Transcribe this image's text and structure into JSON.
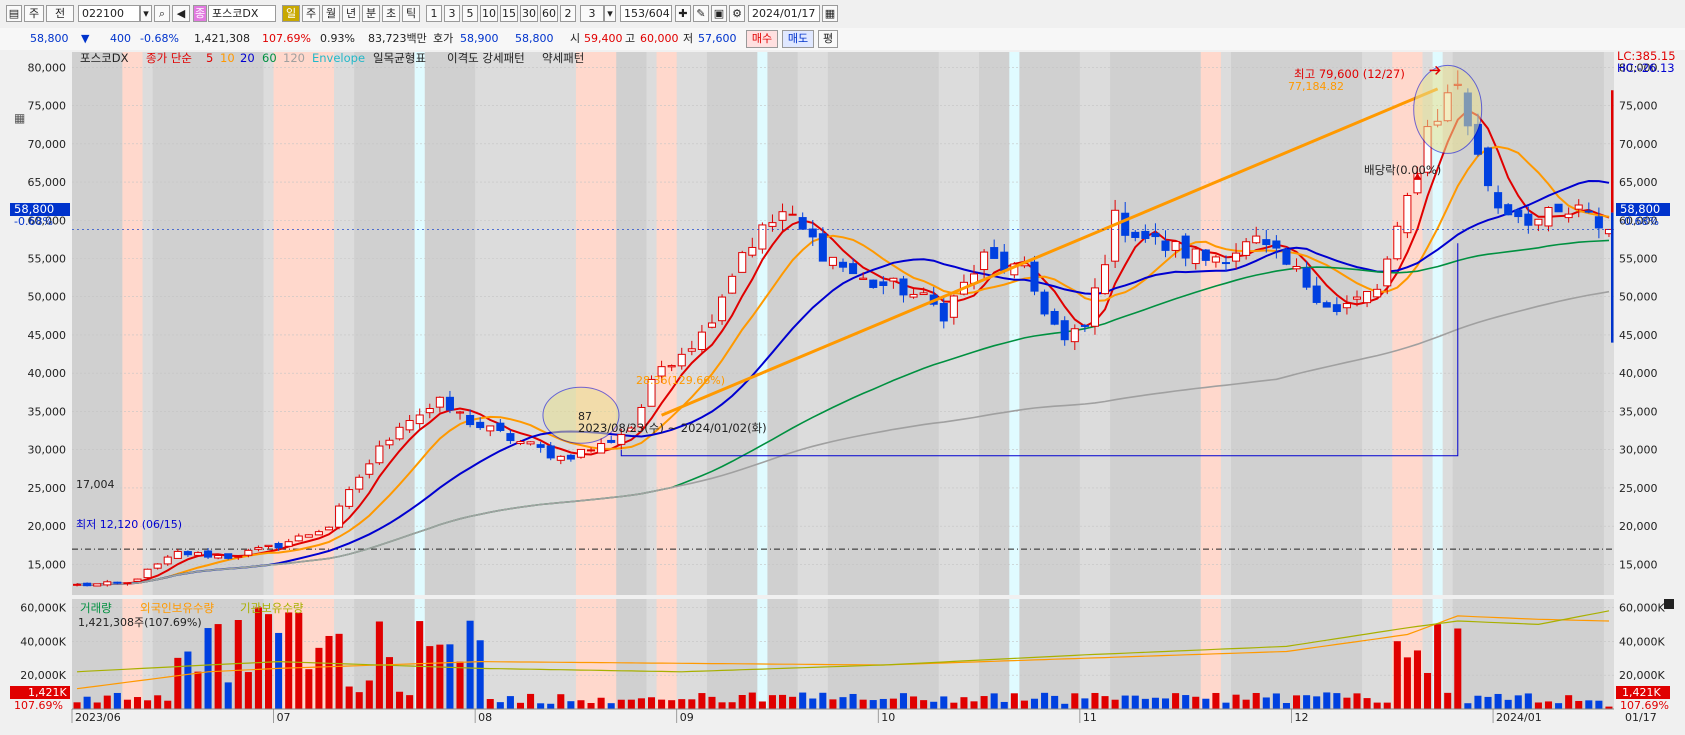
{
  "toolbar": {
    "b_ju": "주",
    "b_jeon": "전",
    "code": "022100",
    "tag": "종",
    "name": "포스코DX",
    "periods": [
      "일",
      "주",
      "월",
      "년",
      "분",
      "초",
      "틱"
    ],
    "nums": [
      "1",
      "3",
      "5",
      "10",
      "15",
      "30",
      "60",
      "2",
      "3"
    ],
    "count": "153/604",
    "date": "2024/01/17"
  },
  "infobar": {
    "price": "58,800",
    "change": "400",
    "change_pct": "-0.68%",
    "volume": "1,421,308",
    "vol_ratio": "107.69%",
    "turnover": "0.93%",
    "amount": "83,723백만",
    "quote_label": "호가",
    "quote": "58,900",
    "quote2": "58,800",
    "open_label": "시",
    "open": "59,400",
    "high_label": "고",
    "high": "60,000",
    "low_label": "저",
    "low": "57,600",
    "buy": "매수",
    "sell": "매도",
    "avg": "평"
  },
  "legend": {
    "name": "포스코DX",
    "close_ma": "종가 단순",
    "ma5": "5",
    "ma10": "10",
    "ma20": "20",
    "ma60": "60",
    "ma120": "120",
    "envelope": "Envelope",
    "ichimoku": "일목균형표",
    "pattern": "이격도 강세패턴",
    "pattern2": "약세패턴"
  },
  "vol_legend": {
    "volume": "거래량",
    "foreign": "외국인보유수량",
    "inst": "기관보유수량",
    "vol_value": "1,421,308주(107.69%)"
  },
  "annotations": {
    "high": "최고 79,600 (12/27)",
    "trend_end": "77,184.82",
    "dividend": "배당락(0.00%)",
    "trend_start": "28.36(129.66%)",
    "range": "2023/08/23(수) ~ 2024/01/02(화)",
    "bars": "87",
    "low": "최저 12,120 (06/15)",
    "hline": "17,004"
  },
  "right_badge": {
    "lc": "LC:385.15",
    "hc": "HC:-26.13",
    "price": "58,800",
    "pct": "-0.68%"
  },
  "left_badge": {
    "price": "58,800",
    "pct": "-0.68%"
  },
  "vol_badge": {
    "value": "1,421K",
    "pct": "107.69%"
  },
  "chart_data": {
    "type": "candlestick",
    "y_ticks": [
      15000,
      20000,
      25000,
      30000,
      35000,
      40000,
      45000,
      50000,
      55000,
      60000,
      65000,
      70000,
      75000,
      80000
    ],
    "y_tick_labels": [
      "15,000",
      "20,000",
      "25,000",
      "30,000",
      "35,000",
      "40,000",
      "45,000",
      "50,000",
      "55,000",
      "60,000",
      "65,000",
      "70,000",
      "75,000",
      "80,000"
    ],
    "ylim": [
      11000,
      82000
    ],
    "vol_ticks": [
      "20,000K",
      "40,000K",
      "60,000K"
    ],
    "vol_tick_values": [
      20000,
      40000,
      60000
    ],
    "vol_ylim": [
      0,
      65000
    ],
    "x_labels": [
      "2023/06",
      "07",
      "08",
      "09",
      "10",
      "11",
      "12",
      "2024/01",
      "01/17"
    ],
    "x_label_index": [
      0,
      20,
      40,
      60,
      80,
      100,
      121,
      141,
      152
    ],
    "key_points": [
      [
        0,
        12300
      ],
      [
        5,
        12500
      ],
      [
        10,
        16500
      ],
      [
        15,
        16000
      ],
      [
        20,
        17500
      ],
      [
        25,
        20000
      ],
      [
        28,
        26500
      ],
      [
        32,
        33500
      ],
      [
        36,
        36000
      ],
      [
        40,
        33000
      ],
      [
        44,
        31000
      ],
      [
        48,
        29000
      ],
      [
        52,
        30500
      ],
      [
        55,
        33000
      ],
      [
        58,
        41000
      ],
      [
        62,
        45000
      ],
      [
        66,
        56000
      ],
      [
        70,
        61000
      ],
      [
        74,
        56000
      ],
      [
        78,
        52000
      ],
      [
        82,
        51000
      ],
      [
        86,
        48000
      ],
      [
        90,
        55000
      ],
      [
        94,
        53000
      ],
      [
        98,
        44000
      ],
      [
        100,
        46000
      ],
      [
        103,
        60000
      ],
      [
        107,
        57000
      ],
      [
        112,
        55000
      ],
      [
        117,
        57000
      ],
      [
        121,
        53000
      ],
      [
        125,
        48000
      ],
      [
        129,
        51000
      ],
      [
        131,
        58000
      ],
      [
        134,
        72000
      ],
      [
        137,
        78000
      ],
      [
        139,
        68000
      ],
      [
        141,
        62000
      ],
      [
        145,
        60000
      ],
      [
        149,
        61000
      ],
      [
        152,
        58800
      ]
    ],
    "high": [
      137,
      79600
    ],
    "low": [
      1,
      12120
    ],
    "hline": 17004,
    "trendline": {
      "from": [
        58,
        34500
      ],
      "to": [
        135,
        77184.82
      ]
    },
    "range_box": {
      "from_index": 54,
      "to_index": 137,
      "bottom": 29200
    },
    "last_price": 58800,
    "series": [
      {
        "name": "5",
        "color": "#e00000"
      },
      {
        "name": "10",
        "color": "#ff9900"
      },
      {
        "name": "20",
        "color": "#0000d0"
      },
      {
        "name": "60",
        "color": "#009040"
      },
      {
        "name": "120",
        "color": "#a0a0a0"
      }
    ],
    "foreign_key": [
      [
        0,
        12000
      ],
      [
        13,
        22000
      ],
      [
        20,
        24000
      ],
      [
        40,
        28000
      ],
      [
        60,
        27000
      ],
      [
        80,
        26000
      ],
      [
        100,
        30000
      ],
      [
        120,
        34000
      ],
      [
        132,
        44000
      ],
      [
        137,
        55000
      ],
      [
        145,
        53000
      ],
      [
        152,
        52000
      ]
    ],
    "inst_key": [
      [
        0,
        22000
      ],
      [
        13,
        26000
      ],
      [
        20,
        28000
      ],
      [
        40,
        24000
      ],
      [
        60,
        22000
      ],
      [
        80,
        26000
      ],
      [
        100,
        32000
      ],
      [
        120,
        37000
      ],
      [
        132,
        48000
      ],
      [
        137,
        52000
      ],
      [
        145,
        50000
      ],
      [
        152,
        58000
      ]
    ],
    "shade_red": [
      [
        5,
        7
      ],
      [
        20,
        26
      ],
      [
        50,
        54
      ],
      [
        58,
        60
      ],
      [
        112,
        114
      ],
      [
        131,
        134
      ]
    ],
    "shade_gray": [
      [
        0,
        5
      ],
      [
        8,
        19
      ],
      [
        28,
        34
      ],
      [
        35,
        40
      ],
      [
        53,
        57
      ],
      [
        63,
        72
      ],
      [
        75,
        86
      ],
      [
        90,
        100
      ],
      [
        103,
        112
      ],
      [
        115,
        128
      ],
      [
        137,
        152
      ]
    ],
    "shade_cyan": [
      [
        34,
        35
      ],
      [
        68,
        69
      ],
      [
        93,
        94
      ],
      [
        135,
        136
      ]
    ]
  }
}
